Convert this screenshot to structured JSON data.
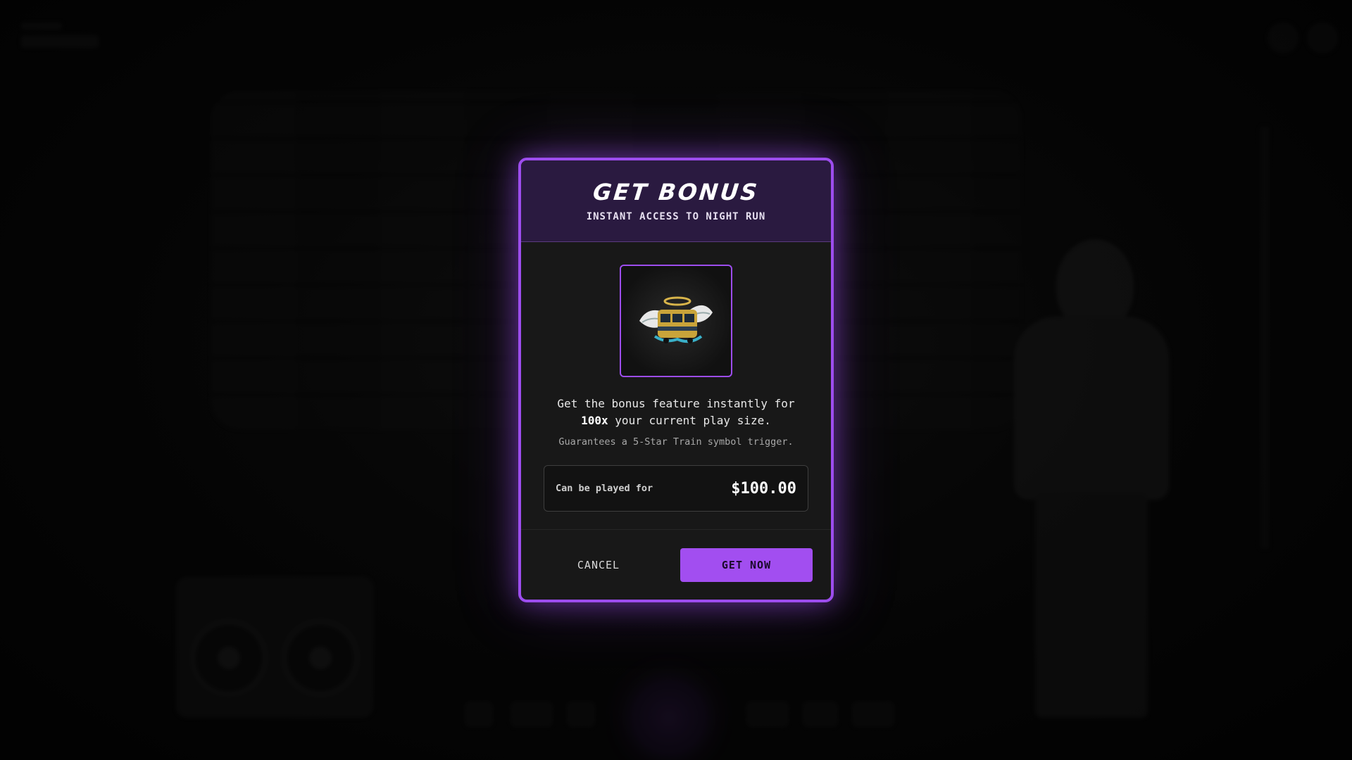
{
  "modal": {
    "title": "GET BONUS",
    "subtitle": "INSTANT ACCESS TO NIGHT RUN",
    "symbol_icon": "winged-train-icon",
    "description_pre": "Get the bonus feature instantly for",
    "multiplier": "100x",
    "description_post": "your current play size.",
    "note": "Guarantees a 5-Star Train symbol trigger.",
    "price_label": "Can be played for",
    "price_value": "$100.00",
    "cancel_label": "CANCEL",
    "confirm_label": "GET NOW"
  },
  "colors": {
    "accent": "#9d4dee",
    "button": "#a24ef0",
    "header_bg": "#2a1a40"
  }
}
